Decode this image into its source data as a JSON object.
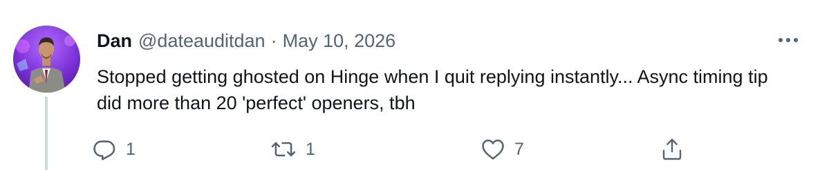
{
  "tweet": {
    "author": {
      "display_name": "Dan",
      "handle": "@dateauditdan"
    },
    "separator": "·",
    "date": "May 10, 2026",
    "text": "Stopped getting ghosted on Hinge when I quit replying instantly... Async timing tip did more than 20 'perfect' openers, tbh",
    "actions": {
      "reply": {
        "icon": "reply-icon",
        "count": "1"
      },
      "retweet": {
        "icon": "retweet-icon",
        "count": "1"
      },
      "like": {
        "icon": "heart-icon",
        "count": "7"
      },
      "share": {
        "icon": "share-icon"
      }
    },
    "more_icon": "more-options-icon"
  },
  "colors": {
    "text_primary": "#0f1419",
    "text_secondary": "#536471",
    "thread_line": "#cfd9de",
    "avatar_bg": "#7a2fd6"
  }
}
